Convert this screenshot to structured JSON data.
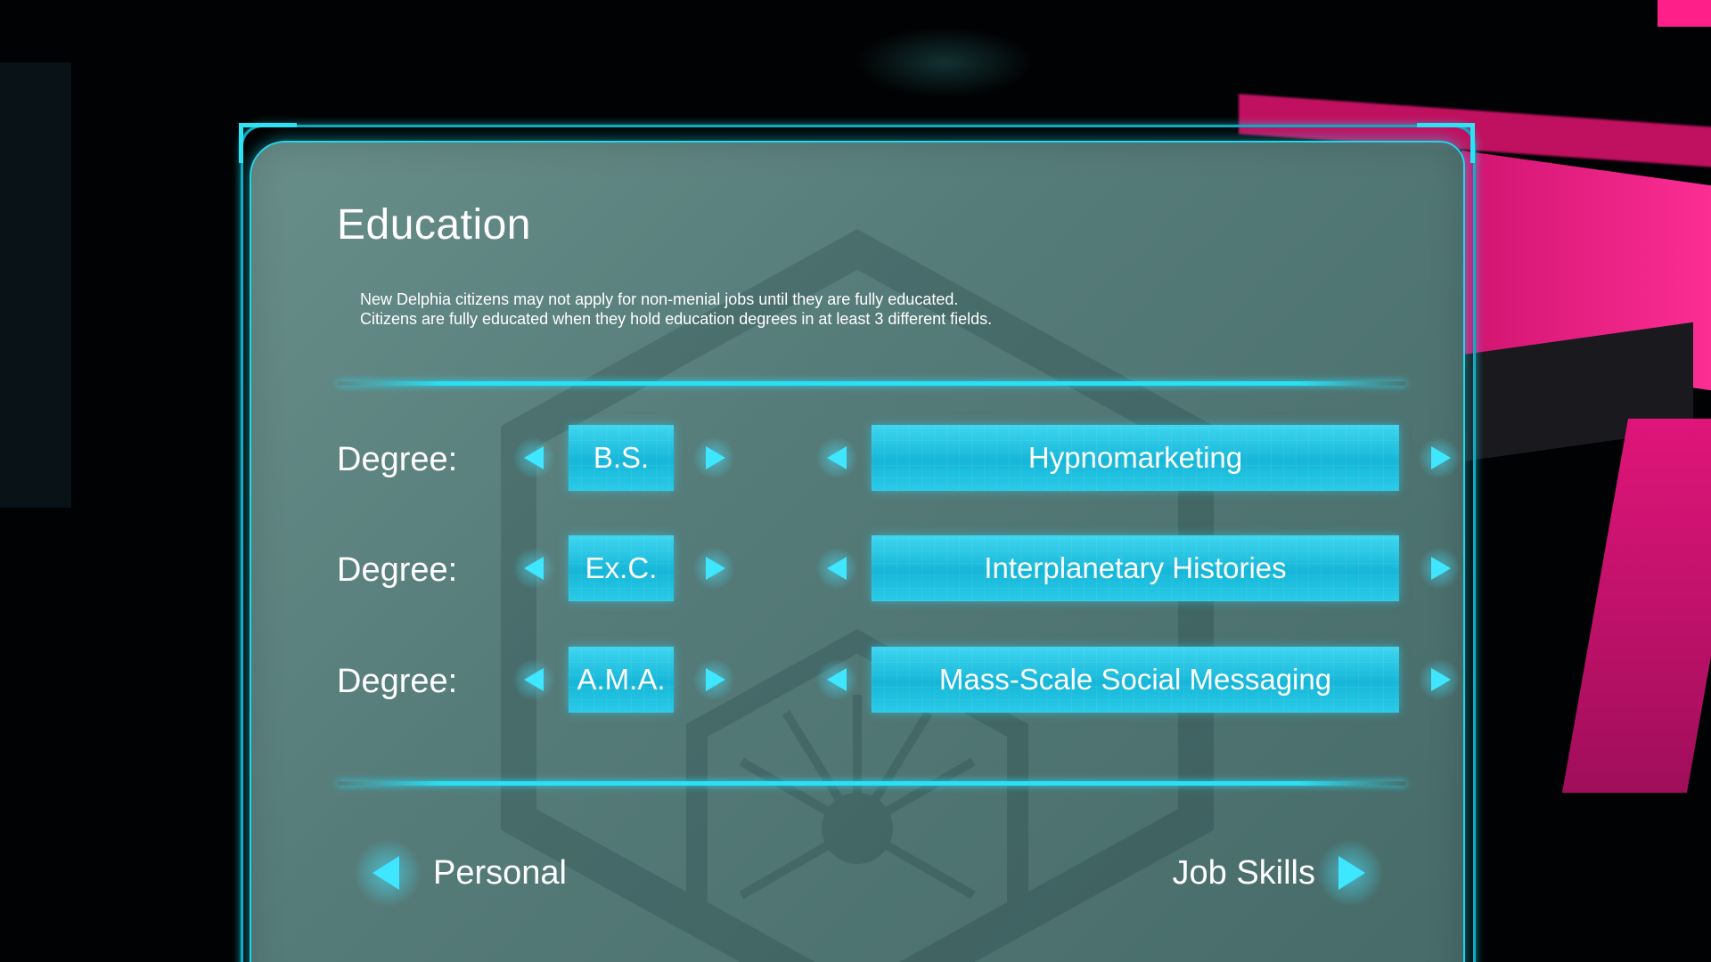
{
  "screen": {
    "title": "Education",
    "description_lines": [
      "New Delphia citizens may not apply for non-menial jobs until they are fully educated.",
      "Citizens are fully educated when they hold education degrees in at least 3 different fields."
    ]
  },
  "degrees": [
    {
      "label": "Degree:",
      "type": "B.S.",
      "field": "Hypnomarketing"
    },
    {
      "label": "Degree:",
      "type": "Ex.C.",
      "field": "Interplanetary Histories"
    },
    {
      "label": "Degree:",
      "type": "A.M.A.",
      "field": "Mass-Scale Social Messaging"
    }
  ],
  "navigation": {
    "prev_label": "Personal",
    "next_label": "Job Skills"
  },
  "colors": {
    "accent": "#2ae0f5",
    "panel": "#5e8a86",
    "background_accent": "#ff1f88"
  },
  "icons": {
    "prev": "chevron-left-icon",
    "next": "chevron-right-icon"
  }
}
